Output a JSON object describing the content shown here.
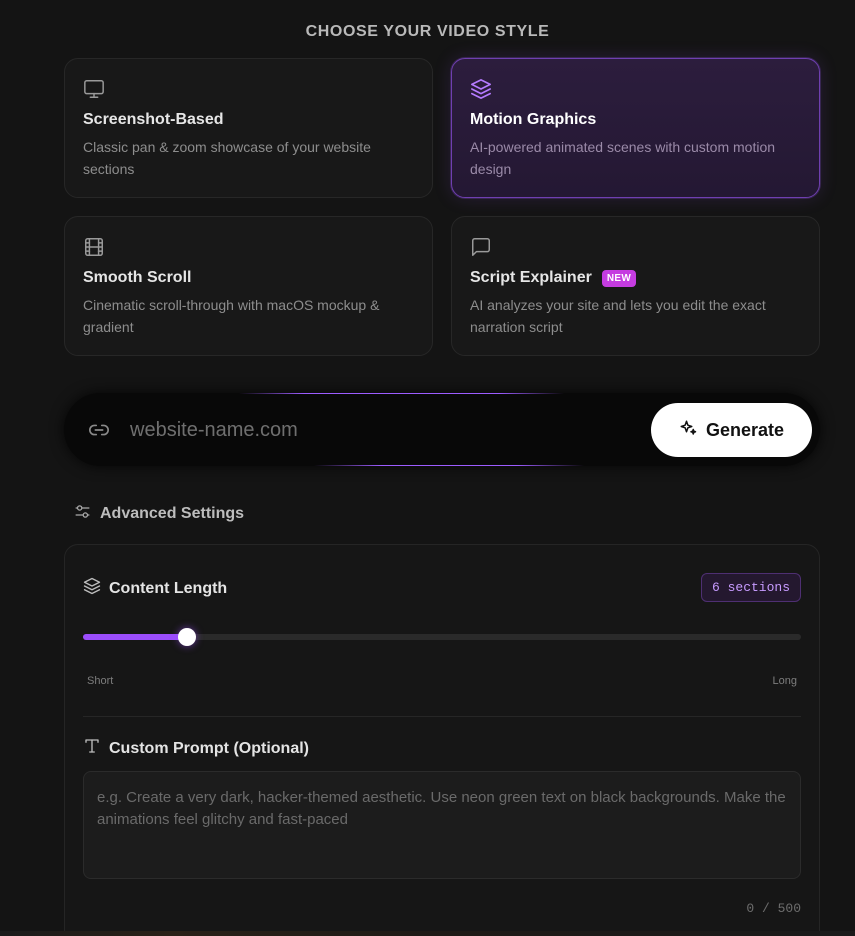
{
  "header": {
    "title": "CHOOSE YOUR VIDEO STYLE"
  },
  "styles": [
    {
      "title": "Screenshot-Based",
      "description": "Classic pan & zoom showcase of your website sections",
      "icon": "monitor-icon",
      "selected": false
    },
    {
      "title": "Motion Graphics",
      "description": "AI-powered animated scenes with custom motion design",
      "icon": "layers-icon",
      "selected": true
    },
    {
      "title": "Smooth Scroll",
      "description": "Cinematic scroll-through with macOS mockup & gradient",
      "icon": "film-icon",
      "selected": false
    },
    {
      "title": "Script Explainer",
      "description": "AI analyzes your site and lets you edit the exact narration script",
      "icon": "message-square-icon",
      "badge": "NEW",
      "selected": false
    }
  ],
  "url_bar": {
    "placeholder": "website-name.com",
    "value": "",
    "generate_label": "Generate"
  },
  "advanced": {
    "toggle_label": "Advanced Settings",
    "content_length": {
      "label": "Content Length",
      "badge": "6 sections",
      "slider_fraction": 0.145,
      "min_label": "Short",
      "max_label": "Long"
    },
    "custom_prompt": {
      "label": "Custom Prompt (Optional)",
      "placeholder": "e.g. Create a very dark, hacker-themed aesthetic. Use neon green text on black backgrounds. Make the animations feel glitchy and fast-paced",
      "value": "",
      "char_count": "0 / 500"
    }
  },
  "colors": {
    "accent": "#9b4dfc",
    "badge_new": "#c53ce0",
    "background": "#141414"
  }
}
